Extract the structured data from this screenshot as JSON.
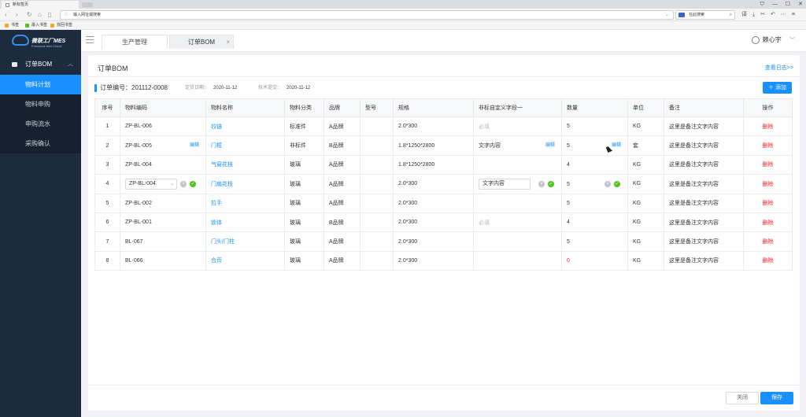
{
  "browser": {
    "tab_title": "新标签页",
    "url_placeholder": "输入网址或搜索",
    "search_engine_placeholder": "在此搜索",
    "bookmarks": [
      "书签",
      "最入书签",
      "找回书签"
    ]
  },
  "sidebar": {
    "logo_title": "微联工厂MES",
    "logo_subtitle": "Friendess Mes Cloud",
    "group": "订单BOM",
    "items": [
      {
        "label": "物料计划",
        "active": true
      },
      {
        "label": "物料申购",
        "active": false
      },
      {
        "label": "申购流水",
        "active": false
      },
      {
        "label": "采购确认",
        "active": false
      }
    ]
  },
  "header": {
    "tabs": [
      {
        "label": "生产管理"
      },
      {
        "label": "订单BOM"
      }
    ],
    "user": "赖心宇"
  },
  "card": {
    "title": "订单BOM",
    "log_link": "查看日志>>",
    "order_label": "订单编号：",
    "order_no": "201112-0008",
    "date_label": "定货日期：",
    "date_value": "2020-11-12",
    "tech_label": "技术提交：",
    "tech_value": "2020-11-12",
    "add_button": "添加"
  },
  "table": {
    "headers": [
      "序号",
      "物料编码",
      "物料名称",
      "物料分类",
      "品牌",
      "型号",
      "规格",
      "非标自定义字段一",
      "数量",
      "单位",
      "备注",
      "操作"
    ],
    "edit_label": "编辑",
    "delete_label": "删除",
    "placeholder": "必填",
    "rows": [
      {
        "no": "1",
        "code": "ZP-BL-006",
        "name": "铰链",
        "category": "标准件",
        "brand": "A品牌",
        "model": "",
        "spec": "2.0*300",
        "custom": "必填",
        "qty": "5",
        "unit": "KG",
        "remark": "这里是备注文字内容"
      },
      {
        "no": "2",
        "code": "ZP-BL-005",
        "name": "门框",
        "category": "非标件",
        "brand": "B品牌",
        "model": "",
        "spec": "1.8*1250*2800",
        "custom": "文字内容",
        "qty": "5",
        "unit": "套",
        "remark": "这里是备注文字内容"
      },
      {
        "no": "3",
        "code": "ZP-BL-004",
        "name": "气窗花枝",
        "category": "玻璃",
        "brand": "A品牌",
        "model": "",
        "spec": "1.8*1250*2800",
        "custom": "",
        "qty": "4",
        "unit": "KG",
        "remark": "这里是备注文字内容"
      },
      {
        "no": "4",
        "code": "ZP-BL-004",
        "name": "门扇花枝",
        "category": "玻璃",
        "brand": "A品牌",
        "model": "",
        "spec": "2.0*300",
        "custom": "文字内容",
        "qty": "5",
        "unit": "KG",
        "remark": "这里是备注文字内容"
      },
      {
        "no": "5",
        "code": "ZP-BL-002",
        "name": "拉手",
        "category": "玻璃",
        "brand": "A品牌",
        "model": "",
        "spec": "2.0*300",
        "custom": "",
        "qty": "5",
        "unit": "KG",
        "remark": "这里是备注文字内容"
      },
      {
        "no": "6",
        "code": "ZP-BL-001",
        "name": "锁体",
        "category": "玻璃",
        "brand": "B品牌",
        "model": "",
        "spec": "2.0*300",
        "custom": "必填",
        "qty": "4",
        "unit": "KG",
        "remark": "这里是备注文字内容"
      },
      {
        "no": "7",
        "code": "BL-067",
        "name": "门头/门柱",
        "category": "玻璃",
        "brand": "A品牌",
        "model": "",
        "spec": "2.0*300",
        "custom": "",
        "qty": "5",
        "unit": "KG",
        "remark": "这里是备注文字内容"
      },
      {
        "no": "8",
        "code": "BL-066",
        "name": "合页",
        "category": "玻璃",
        "brand": "A品牌",
        "model": "",
        "spec": "2.0*300",
        "custom": "",
        "qty": "0",
        "unit": "KG",
        "remark": "这里是备注文字内容"
      }
    ]
  },
  "footer": {
    "close": "关闭",
    "save": "保存"
  },
  "colors": {
    "primary": "#1890ff",
    "danger": "#f5222d",
    "sidebar": "#1c2b3e",
    "success": "#52c41a"
  }
}
